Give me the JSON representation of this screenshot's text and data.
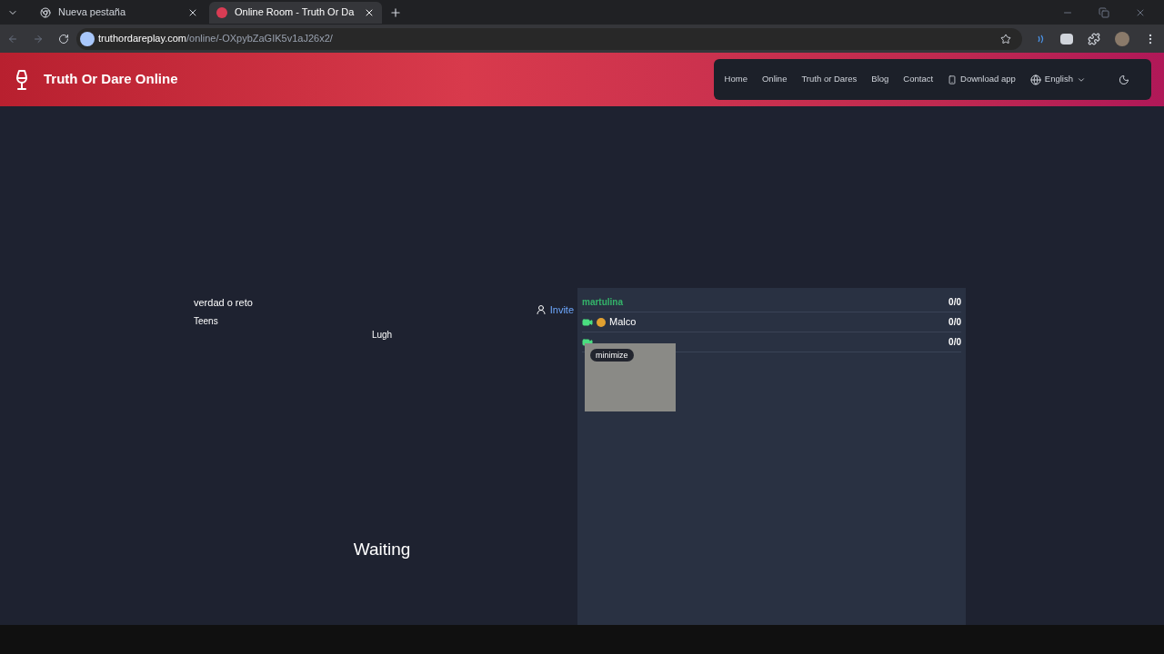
{
  "browser": {
    "tabs": [
      {
        "title": "Nueva pestaña",
        "selected": false
      },
      {
        "title": "Online Room - Truth Or Da",
        "selected": true
      }
    ],
    "url_host": "truthordareplay.com",
    "url_path": "/online/-OXpybZaGIK5v1aJ26x2/"
  },
  "header": {
    "brand": "Truth Or Dare Online",
    "nav": [
      {
        "label": "Home",
        "kind": "link"
      },
      {
        "label": "Online",
        "kind": "link"
      },
      {
        "label": "Truth or Dares",
        "kind": "link"
      },
      {
        "label": "Blog",
        "kind": "link"
      },
      {
        "label": "Contact",
        "kind": "link"
      },
      {
        "label": "Download app",
        "kind": "app"
      },
      {
        "label": "English",
        "kind": "language"
      }
    ]
  },
  "room": {
    "name": "verdad o reto",
    "category": "Teens",
    "current_player": "Lugh",
    "status": "Waiting",
    "invite": "Invite"
  },
  "players": [
    {
      "name": "martulina",
      "score": "0/0",
      "active": true,
      "camera": false
    },
    {
      "name": "Malco",
      "score": "0/0",
      "active": false,
      "camera": true
    },
    {
      "score": "0/0",
      "camera": true
    }
  ],
  "video": {
    "button": "minimize"
  }
}
